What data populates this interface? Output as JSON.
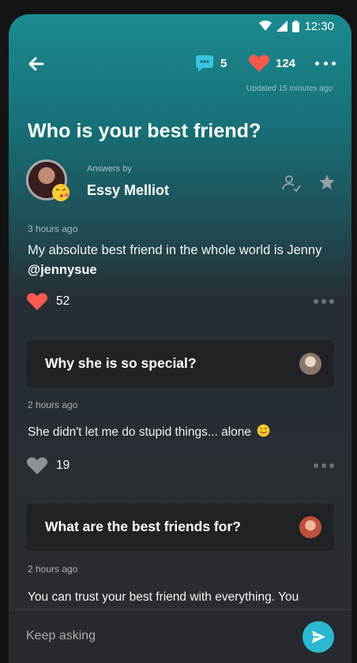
{
  "status_bar": {
    "time": "12:30"
  },
  "header": {
    "comment_count": "5",
    "like_count": "124",
    "updated": "Updated 15 minutes ago"
  },
  "question": {
    "title": "Who is your best friend?"
  },
  "author": {
    "answers_by_label": "Answers by",
    "name": "Essy Melliot"
  },
  "answer": {
    "time": "3 hours ago",
    "text": "My absolute best friend in the whole world is Jenny ",
    "mention": "@jennysue",
    "likes": "52"
  },
  "followups": [
    {
      "question": "Why she is so special?",
      "time": "2 hours ago",
      "text": "She didn't let me do stupid things... alone",
      "likes": "19"
    },
    {
      "question": "What are the best friends for?",
      "time": "2 hours ago",
      "text": "You can trust your best friend with everything. You"
    }
  ],
  "input": {
    "placeholder": "Keep asking"
  },
  "colors": {
    "accent_teal": "#1c8a90",
    "heart_red": "#ff5a4e",
    "send_blue": "#2ab8d1",
    "card_bg": "#1f2326"
  },
  "icons": {
    "back": "arrow-left-icon",
    "comments": "chat-bubble-icon",
    "likes": "heart-icon",
    "more": "more-horizontal-icon",
    "follow": "add-user-icon",
    "star": "star-icon",
    "send": "send-icon"
  }
}
